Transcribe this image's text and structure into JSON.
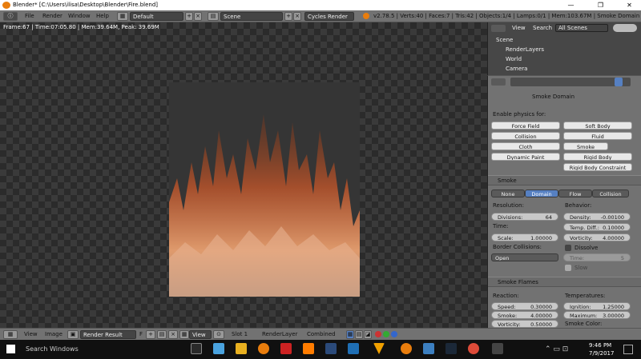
{
  "window": {
    "title": "Blender* [C:\\Users\\ilisa\\Desktop\\Blender\\Fire.blend]",
    "min": "—",
    "max": "❐",
    "close": "✕"
  },
  "header": {
    "menus": [
      "File",
      "Render",
      "Window",
      "Help"
    ],
    "layout": "Default",
    "scene": "Scene",
    "engine": "Cycles Render",
    "stats": "v2.78.5 | Verts:40 | Faces:7 | Tris:42 | Objects:1/4 | Lamps:0/1 | Mem:103.67M | Smoke Domain"
  },
  "viewport": {
    "info": "Frame:67 | Time:07:05.80 | Mem:39.64M, Peak: 39.69M"
  },
  "outliner": {
    "view": "View",
    "search": "Search",
    "filter": "All Scenes",
    "items": [
      "Scene",
      "RenderLayers",
      "World",
      "Camera"
    ]
  },
  "props": {
    "context": "Smoke Domain",
    "enable_label": "Enable physics for:",
    "physics_left": [
      "Force Field",
      "Collision",
      "Cloth",
      "Dynamic Paint"
    ],
    "physics_right": [
      "Soft Body",
      "Fluid",
      "Smoke",
      "Rigid Body",
      "Rigid Body Constraint"
    ],
    "smoke": {
      "title": "Smoke",
      "tabs": [
        "None",
        "Domain",
        "Flow",
        "Collision"
      ],
      "resolution_label": "Resolution:",
      "divisions_label": "Divisions:",
      "divisions": "64",
      "time_label": "Time:",
      "scale_label": "Scale:",
      "scale": "1.00000",
      "border_label": "Border Collisions:",
      "border_value": "Open",
      "behavior_label": "Behavior:",
      "density_label": "Density:",
      "density": "-0.00100",
      "temp_label": "Temp. Diff.:",
      "temp": "0.10000",
      "vorticity_label": "Vorticity:",
      "vorticity": "4.00000",
      "dissolve_label": "Dissolve",
      "time2_label": "Time:",
      "time2": "5",
      "slow_label": "Slow"
    },
    "flames": {
      "title": "Smoke Flames",
      "reaction_label": "Reaction:",
      "speed_label": "Speed:",
      "speed": "0.30000",
      "smoke_label": "Smoke:",
      "smoke": "4.00000",
      "vorticity_label": "Vorticity:",
      "vorticity": "0.50000",
      "temps_label": "Temperatures:",
      "ignition_label": "Ignition:",
      "ignition": "1.25000",
      "maximum_label": "Maximum:",
      "maximum": "3.00000",
      "color_label": "Smoke Color:"
    }
  },
  "bottom": {
    "view": "View",
    "image": "Image",
    "render_result": "Render Result",
    "f": "F",
    "view2": "View",
    "slot": "Slot 1",
    "layer": "RenderLayer",
    "pass": "Combined"
  },
  "taskbar": {
    "search": "Search Windows",
    "time": "9:46 PM",
    "date": "7/9/2017"
  }
}
